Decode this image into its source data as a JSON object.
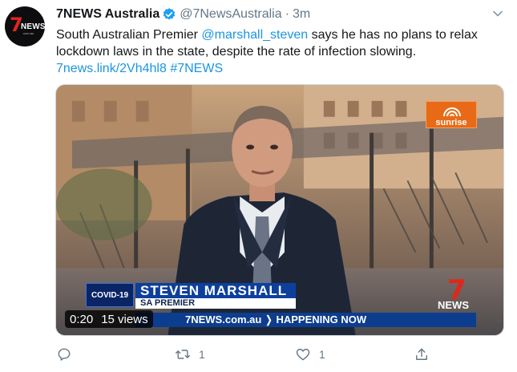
{
  "account": {
    "display_name": "7NEWS Australia",
    "handle": "@7NewsAustralia",
    "separator": "·",
    "time": "3m",
    "avatar_text": {
      "seven": "7",
      "news": "NEWS",
      "sub": ".com.au"
    }
  },
  "tweet": {
    "text_before_mention": "South Australian Premier ",
    "mention": "@marshall_steven",
    "text_after_mention": " says he has no plans to relax lockdown laws in the state, despite the rate of infection slowing.",
    "link": "7news.link/2Vh4hl8",
    "hashtag": "#7NEWS"
  },
  "media": {
    "brand_logo": "sunrise",
    "badge": "COVID-19",
    "lower_third_name": "STEVEN MARSHALL",
    "lower_third_title": "SA PREMIER",
    "ticker": "7NEWS.com.au ❭ HAPPENING NOW",
    "corner_logo": {
      "seven": "7",
      "news": "NEWS"
    },
    "duration": "0:20",
    "views": "15 views"
  },
  "actions": {
    "reply_count": "",
    "retweet_count": "1",
    "like_count": "1",
    "share_count": ""
  },
  "colors": {
    "link_blue": "#1b95e0",
    "verified_blue": "#1da1f2",
    "muted_gray": "#657786",
    "brand_red": "#e1261c"
  }
}
